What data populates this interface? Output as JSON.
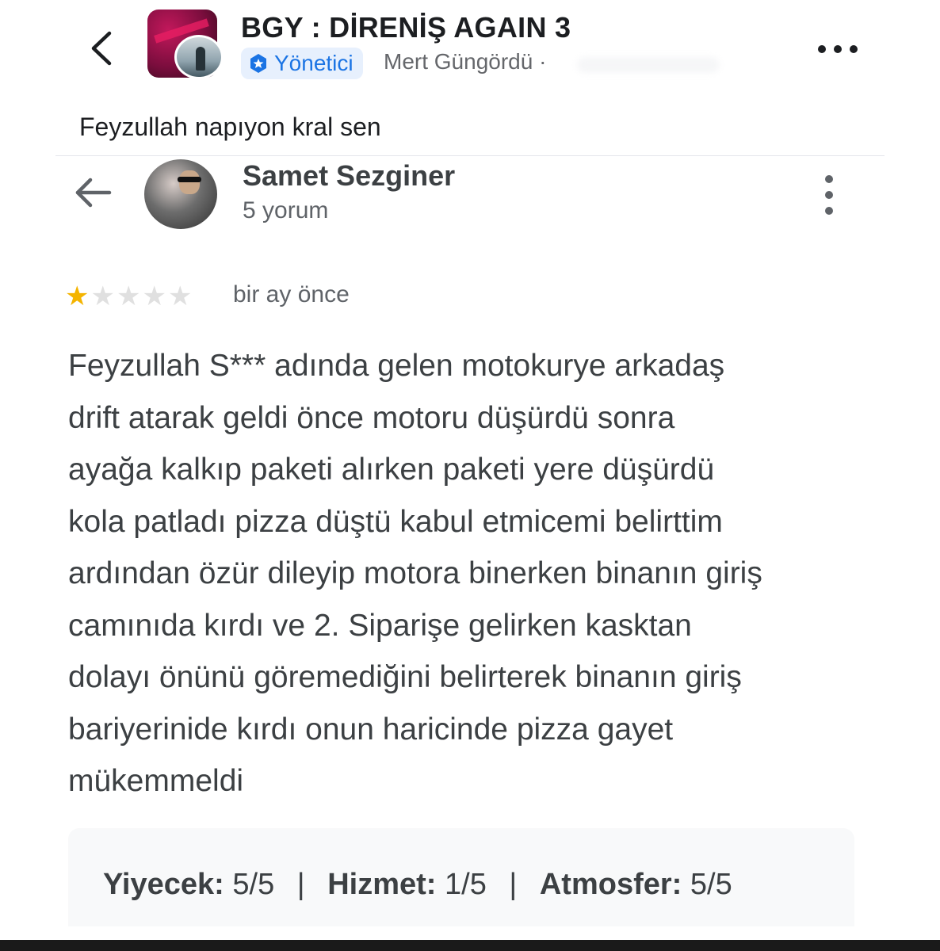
{
  "post": {
    "group_title": "BGY : DİRENİŞ AGAIN 3",
    "admin_badge": "Yönetici",
    "author": "Mert Güngördü ·",
    "caption": "Feyzullah napıyon kral sen"
  },
  "review": {
    "reviewer_name": "Samet Sezginer",
    "review_count": "5 yorum",
    "rating": 1,
    "rating_max": 5,
    "date": "bir ay önce",
    "text_lines": [
      "Feyzullah S*** adında gelen motokurye arkadaş",
      "drift atarak geldi önce motoru düşürdü sonra",
      "ayağa kalkıp paketi alırken paketi yere düşürdü",
      "kola patladı pizza düştü kabul etmicemi belirttim",
      "ardından özür dileyip motora binerken binanın giriş",
      "camınıda kırdı ve 2. Siparişe gelirken kasktan",
      "dolayı önünü göremediğini belirterek binanın giriş",
      "bariyerinide kırdı onun haricinde pizza gayet",
      "mükemmeldi"
    ],
    "sub_ratings": [
      {
        "label": "Yiyecek:",
        "value": "5/5"
      },
      {
        "label": "Hizmet:",
        "value": "1/5"
      },
      {
        "label": "Atmosfer:",
        "value": "5/5"
      }
    ],
    "separator": "|"
  },
  "icons": {
    "back": "chevron-left-icon",
    "more": "more-horizontal-icon",
    "review_back": "arrow-left-icon",
    "review_more": "more-vertical-icon",
    "admin": "shield-star-icon"
  },
  "colors": {
    "admin_blue": "#1b74e4",
    "star_gold": "#f4b400",
    "star_gray": "#e0e0e0",
    "review_text": "#3c4043"
  }
}
